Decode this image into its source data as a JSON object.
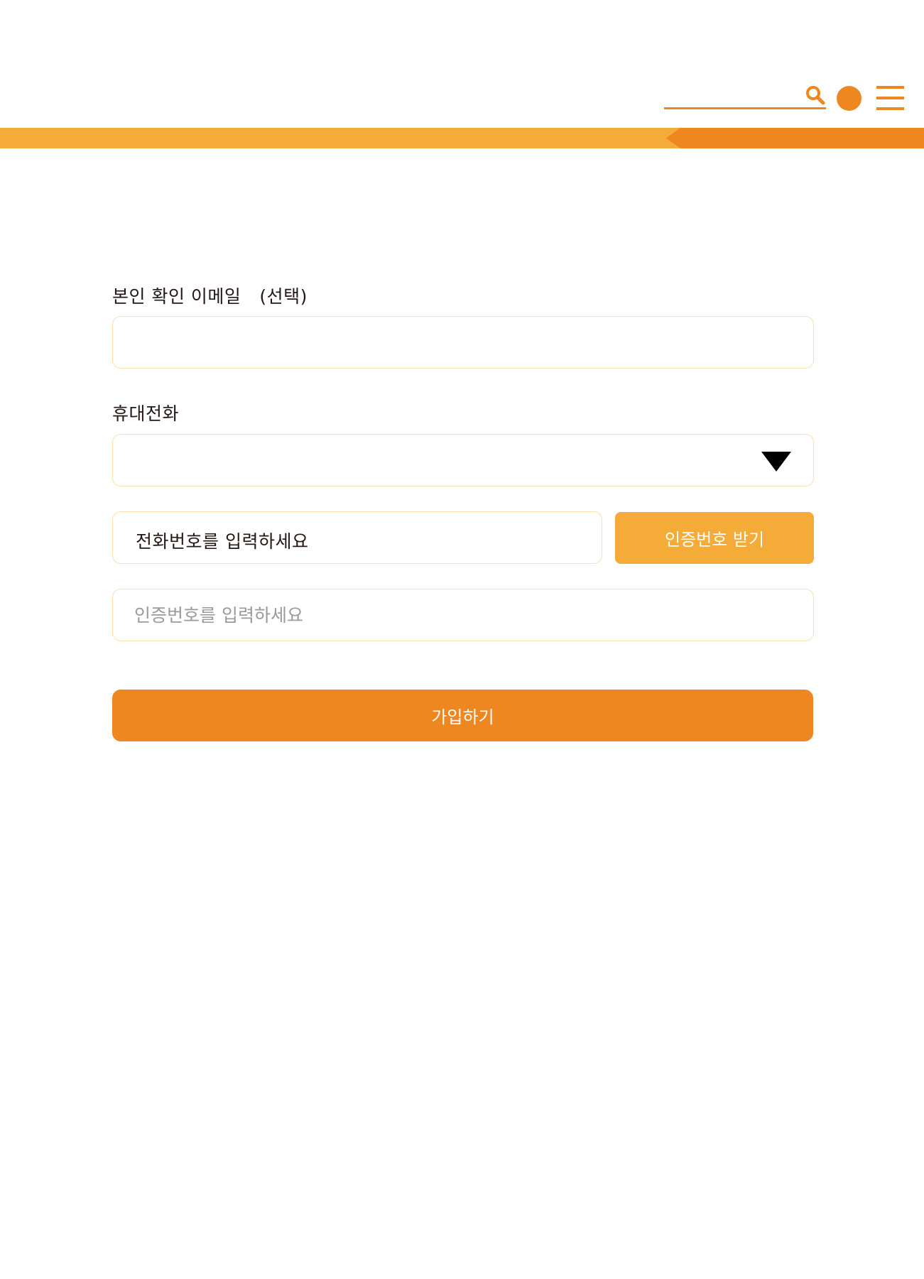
{
  "header": {
    "search_icon": "search-icon",
    "profile_icon": "circle-icon",
    "menu_icon": "hamburger-menu-icon"
  },
  "form": {
    "email_label": "본인 확인 이메일",
    "email_optional": "(선택)",
    "email_value": "",
    "phone_label": "휴대전화",
    "carrier_value": "",
    "phone_value": "전화번호를 입력하세요",
    "request_code_button": "인증번호 받기",
    "code_placeholder": "인증번호를 입력하세요",
    "submit_button": "가입하기"
  },
  "colors": {
    "primary": "#ef8720",
    "secondary": "#f5ab38",
    "field_border": "#fde0ae",
    "text": "#231815"
  }
}
